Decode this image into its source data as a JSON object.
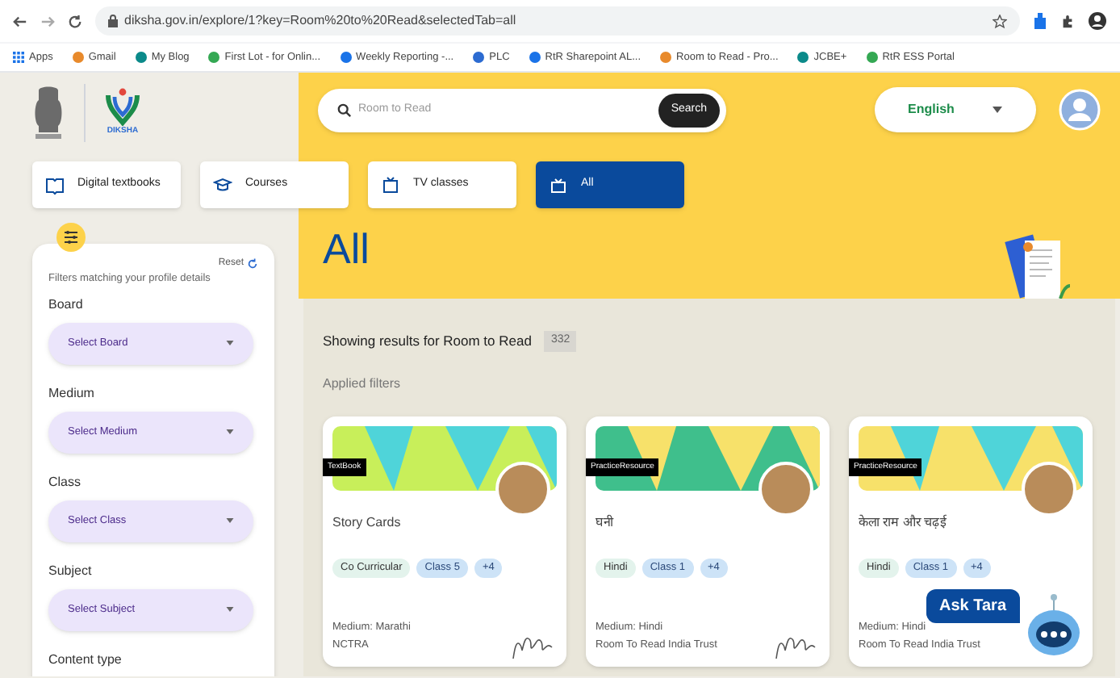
{
  "browser": {
    "url": "diksha.gov.in/explore/1?key=Room%20to%20Read&selectedTab=all",
    "bookmarks": [
      "Apps",
      "Gmail",
      "My Blog",
      "First Lot - for Onlin...",
      "Weekly Reporting -...",
      "PLC",
      "RtR Sharepoint AL...",
      "Room to Read - Pro...",
      "JCBE+",
      "RtR ESS Portal"
    ]
  },
  "header": {
    "logo_text": "DIKSHA",
    "search": {
      "placeholder": "Room to Read",
      "button": "Search"
    },
    "language": "English"
  },
  "tabs": [
    {
      "label": "Digital textbooks",
      "selected": false
    },
    {
      "label": "Courses",
      "selected": false
    },
    {
      "label": "TV classes",
      "selected": false
    },
    {
      "label": "All",
      "selected": true
    }
  ],
  "filters": {
    "reset": "Reset",
    "note": "Filters matching your profile details",
    "groups": [
      {
        "label": "Board",
        "placeholder": "Select Board"
      },
      {
        "label": "Medium",
        "placeholder": "Select Medium"
      },
      {
        "label": "Class",
        "placeholder": "Select Class"
      },
      {
        "label": "Subject",
        "placeholder": "Select Subject"
      },
      {
        "label": "Content type"
      }
    ]
  },
  "heading": "All",
  "results": {
    "text": "Showing results for Room to Read",
    "count": "332",
    "applied_filters": "Applied filters"
  },
  "cards": [
    {
      "tag": "TextBook",
      "title": "Story Cards",
      "chips": [
        "Co Curricular",
        "Class 5",
        "+4"
      ],
      "medium": "Medium: Marathi",
      "publisher": "NCTRA"
    },
    {
      "tag": "PracticeResource",
      "title": "घनी",
      "chips": [
        "Hindi",
        "Class 1",
        "+4"
      ],
      "medium": "Medium: Hindi",
      "publisher": "Room To Read India Trust"
    },
    {
      "tag": "PracticeResource",
      "title": "केला राम और चढ़ई",
      "chips": [
        "Hindi",
        "Class 1",
        "+4"
      ],
      "medium": "Medium: Hindi",
      "publisher": "Room To Read India Trust"
    }
  ],
  "assistant": {
    "label": "Ask Tara"
  }
}
